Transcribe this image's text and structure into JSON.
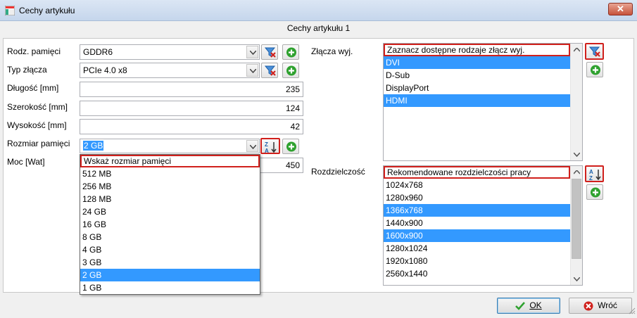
{
  "window": {
    "title": "Cechy artykułu"
  },
  "header": {
    "title": "Cechy artykułu 1"
  },
  "fields": {
    "rodz_pamieci": {
      "label": "Rodz. pamięci",
      "value": "GDDR6"
    },
    "typ_zlacza": {
      "label": "Typ złącza",
      "value": "PCIe 4.0 x8"
    },
    "dlugosc": {
      "label": "Długość [mm]",
      "value": "235"
    },
    "szerokosc": {
      "label": "Szerokość [mm]",
      "value": "124"
    },
    "wysokosc": {
      "label": "Wysokość [mm]",
      "value": "42"
    },
    "rozmiar_pamieci": {
      "label": "Rozmiar pamięci",
      "value": "2 GB"
    },
    "moc": {
      "label": "Moc [Wat]",
      "value": "450"
    }
  },
  "rozmiar_dropdown": {
    "items": [
      "Wskaż rozmiar pamięci",
      "512 MB",
      "256 MB",
      "128 MB",
      "24 GB",
      "16 GB",
      "8 GB",
      "4 GB",
      "3 GB",
      "2 GB",
      "1 GB"
    ],
    "selected_index": 9
  },
  "zlacza": {
    "label": "Złącza wyj.",
    "header": "Zaznacz dostępne rodzaje złącz wyj.",
    "items": [
      "DVI",
      "D-Sub",
      "DisplayPort",
      "HDMI"
    ],
    "selected": [
      0,
      3
    ]
  },
  "rozdzielczosc": {
    "label": "Rozdzielczość",
    "header": "Rekomendowane rozdzielczości pracy",
    "items": [
      "1024x768",
      "1280x960",
      "1366x768",
      "1440x900",
      "1600x900",
      "1280x1024",
      "1920x1080",
      "2560x1440"
    ],
    "selected": [
      2,
      4
    ]
  },
  "buttons": {
    "ok": "OK",
    "back": "Wróć"
  },
  "colors": {
    "selection": "#3399ff",
    "highlight_border": "#d0201c",
    "add_green": "#2ea12e"
  }
}
